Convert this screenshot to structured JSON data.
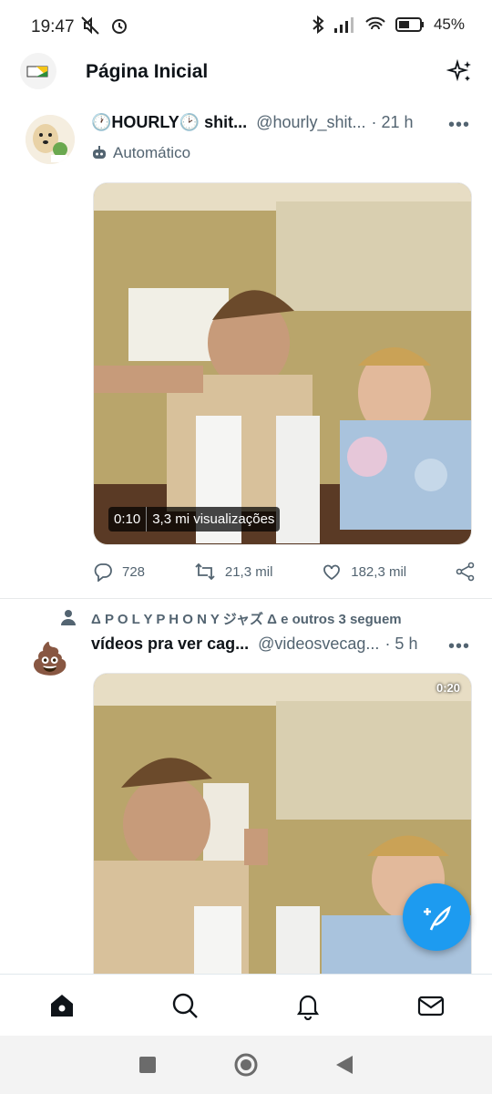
{
  "status_bar": {
    "time": "19:47",
    "battery": "45%"
  },
  "header": {
    "title": "Página Inicial"
  },
  "tweets": [
    {
      "name_prefix": "🕐HOURLY🕑 shit...",
      "handle": "@hourly_shit...",
      "time": "· 21 h",
      "automated_label": "Automático",
      "video": {
        "duration": "0:10",
        "views": "3,3 mi visualizações"
      },
      "stats": {
        "replies": "728",
        "retweets": "21,3 mil",
        "likes": "182,3 mil"
      }
    },
    {
      "social_context": "Δ P O L Y P H O N Y ジャズ Δ e outros 3 seguem",
      "name": "vídeos pra ver cag...",
      "handle": "@videosvecag...",
      "time": "· 5 h",
      "avatar_emoji": "💩",
      "video": {
        "duration": "0:20"
      }
    }
  ],
  "more_glyph": "•••",
  "nav": [
    "home-icon",
    "search-icon",
    "notifications-icon",
    "messages-icon"
  ],
  "colors": {
    "accent": "#1d9bf0",
    "text": "#0f1419",
    "muted": "#536471"
  }
}
